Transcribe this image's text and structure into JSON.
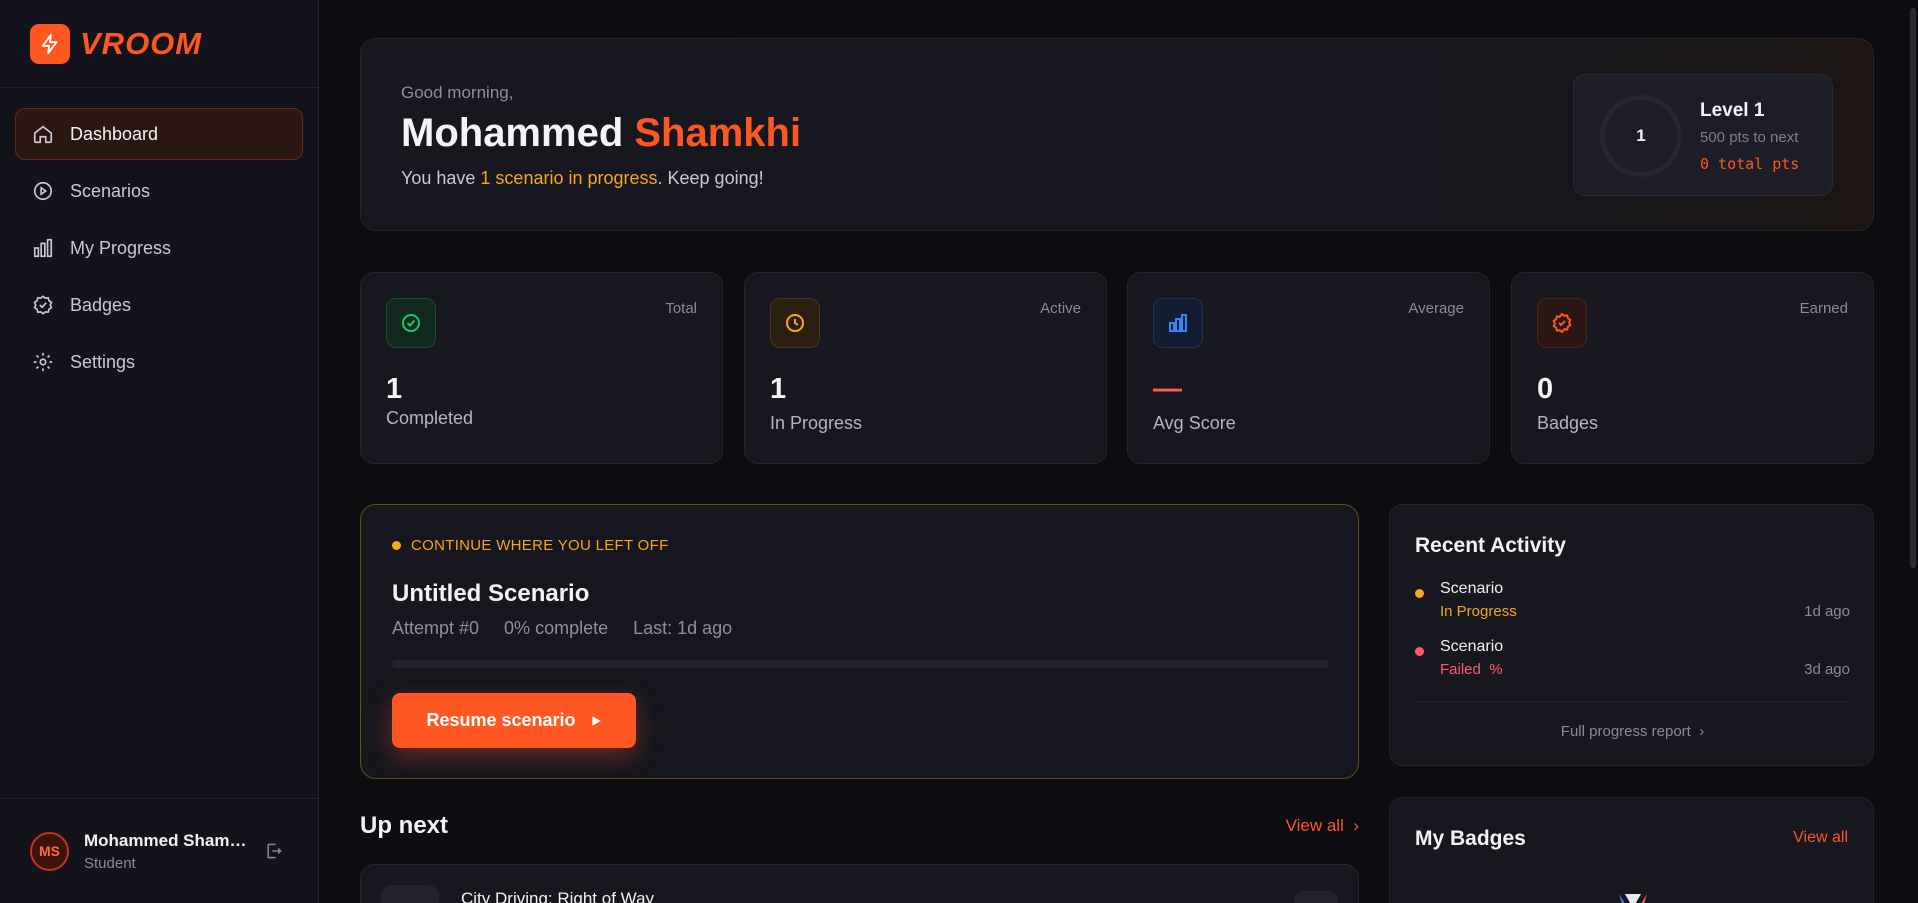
{
  "app": {
    "logo_text": "VROOM"
  },
  "sidebar": {
    "items": [
      {
        "label": "Dashboard",
        "icon": "home-icon",
        "active": true
      },
      {
        "label": "Scenarios",
        "icon": "play-circle-icon",
        "active": false
      },
      {
        "label": "My Progress",
        "icon": "bar-chart-icon",
        "active": false
      },
      {
        "label": "Badges",
        "icon": "badge-check-icon",
        "active": false
      },
      {
        "label": "Settings",
        "icon": "gear-icon",
        "active": false
      }
    ],
    "user": {
      "initials": "MS",
      "name": "Mohammed Shamkhi",
      "role": "Student"
    }
  },
  "hero": {
    "greeting": "Good morning,",
    "first_name": "Mohammed",
    "last_name": "Shamkhi",
    "sub_prefix": "You have ",
    "sub_highlight": "1 scenario in progress",
    "sub_suffix": ". Keep going!",
    "level": {
      "ring_value": "1",
      "title": "Level 1",
      "next": "500 pts to next",
      "total": "0 total pts"
    }
  },
  "stats": [
    {
      "tag": "Total",
      "value": "1",
      "label": "Completed",
      "icon": "check-circle-icon",
      "color": "#22c55e"
    },
    {
      "tag": "Active",
      "value": "1",
      "label": "In Progress",
      "icon": "clock-icon",
      "color": "#f5a623"
    },
    {
      "tag": "Average",
      "value": "—",
      "label": "Avg Score",
      "icon": "bar-chart-icon",
      "color": "#3b82f6"
    },
    {
      "tag": "Earned",
      "value": "0",
      "label": "Badges",
      "icon": "badge-check-icon",
      "color": "#ff5722"
    }
  ],
  "continue": {
    "tag": "CONTINUE WHERE YOU LEFT OFF",
    "title": "Untitled Scenario",
    "attempt": "Attempt #0",
    "complete": "0% complete",
    "last": "Last: 1d ago",
    "progress": 0,
    "resume_label": "Resume scenario"
  },
  "activity": {
    "title": "Recent Activity",
    "items": [
      {
        "name": "Scenario",
        "status": "In Progress",
        "time": "1d ago",
        "color": "#f5a623"
      },
      {
        "name": "Scenario",
        "status": "Failed  %",
        "time": "3d ago",
        "color": "#ff5b6b"
      }
    ],
    "full_report": "Full progress report"
  },
  "upnext": {
    "title": "Up next",
    "view_all": "View all",
    "first_item": "City Driving: Right of Way"
  },
  "badges_card": {
    "title": "My Badges",
    "view_all": "View all"
  }
}
